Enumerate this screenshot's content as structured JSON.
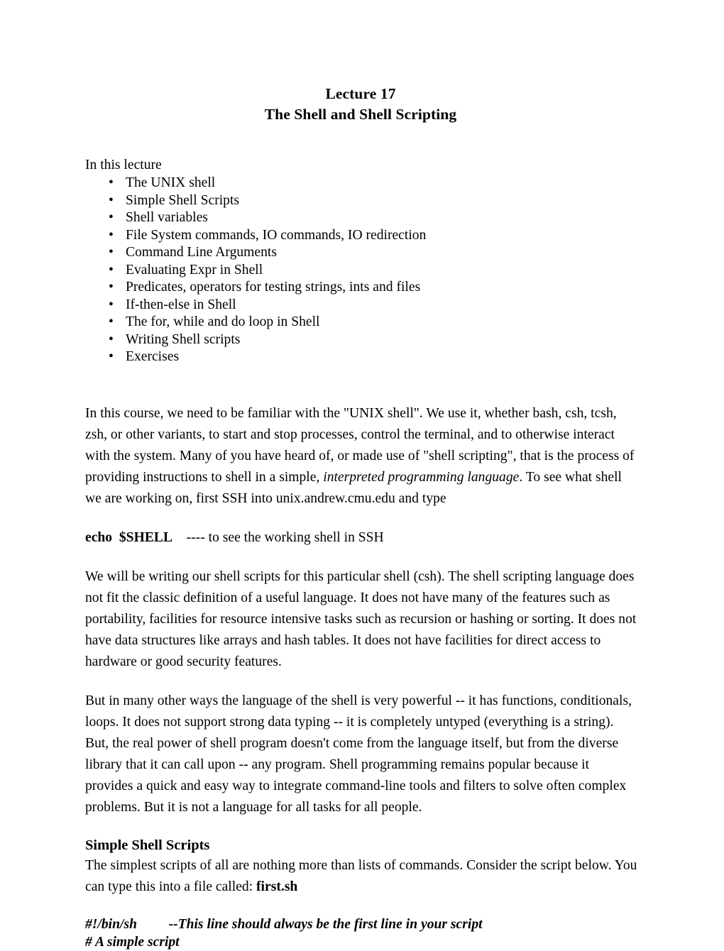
{
  "document": {
    "title_lines": [
      "Lecture 17",
      "The Shell and Shell Scripting"
    ],
    "intro_label": "In this lecture",
    "bullet_marker": "•",
    "bullets": [
      "The UNIX shell",
      "Simple Shell Scripts",
      "Shell variables",
      "File System commands, IO commands, IO redirection",
      "Command Line Arguments",
      "Evaluating Expr in Shell",
      "Predicates, operators for testing strings, ints and files",
      "If-then-else in Shell",
      "The for, while and do loop in Shell",
      "Writing Shell scripts",
      "Exercises"
    ],
    "paragraph_1": {
      "part_1": "In this course, we need to be familiar with the \"UNIX shell\". We use it, whether bash, csh, tcsh, zsh, or other variants, to start and stop processes, control the terminal, and to otherwise interact with the system. Many of you have heard of, or made use of \"shell scripting\", that is the process of providing instructions to shell in a simple, ",
      "italic": "interpreted programming language",
      "part_2": ". To see what shell we are working on, first SSH into unix.andrew.cmu.edu and type"
    },
    "command_line": {
      "command": "echo  $SHELL",
      "comment": "    ---- to see the working shell in SSH"
    },
    "paragraph_2": "We will be writing our shell scripts for this particular shell (csh). The shell scripting language does not fit the classic definition of a useful language. It does not have many of the features such as portability, facilities for resource intensive tasks such as recursion or hashing or sorting. It does not have data structures like arrays and hash tables. It does not have facilities for direct access to hardware or good security features.",
    "paragraph_3": "But in many other ways the language of the shell is very powerful -- it has functions, conditionals, loops. It does not support strong data typing -- it is completely untyped (everything is a string). But, the real power of shell program doesn't come from the language itself, but from the diverse library that it can call upon -- any program. Shell programming remains popular because it provides a quick and easy way to integrate command-line tools and filters to solve often complex problems. But it is not a language for all tasks for all people.",
    "section_heading": "Simple Shell Scripts",
    "paragraph_4": {
      "part_1": "The simplest scripts of all are nothing more than lists of commands. Consider the script below. You can type this into a file called: ",
      "bold": "first.sh"
    },
    "script_lines": [
      "#!/bin/sh\t\t--This line should always be the first line in your script",
      "# A simple script"
    ]
  }
}
